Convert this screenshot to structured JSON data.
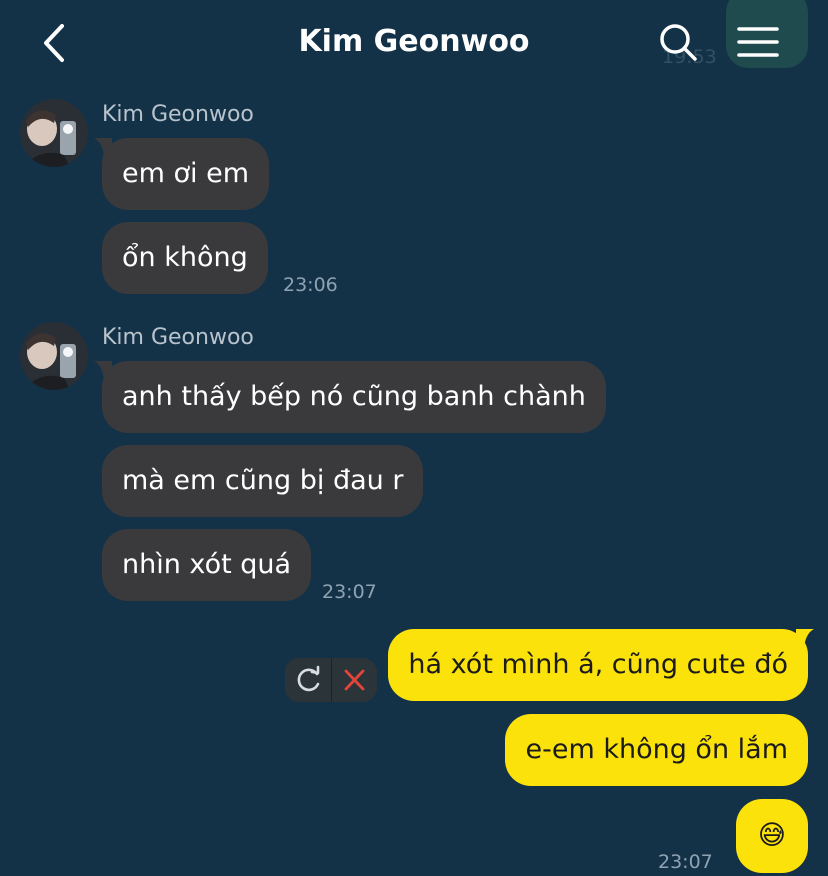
{
  "header": {
    "title": "Kim Geonwoo",
    "ghost_time": "19:53"
  },
  "groups": [
    {
      "sender": "Kim Geonwoo",
      "messages": [
        "em ơi em",
        "ổn không"
      ],
      "time": "23:06"
    },
    {
      "sender": "Kim Geonwoo",
      "messages": [
        "anh thấy bếp nó cũng banh chành",
        "mà em cũng bị đau r",
        "nhìn xót quá"
      ],
      "time": "23:07"
    }
  ],
  "outgoing": {
    "messages": [
      "há xót mình á, cũng cute đó",
      "e-em không ổn lắm",
      "😅"
    ],
    "time": "23:07"
  },
  "colors": {
    "background": "#133248",
    "incoming_bubble": "#3a3a3c",
    "outgoing_bubble": "#fbe20b",
    "failed_action_red": "#e0443a"
  },
  "icons": [
    "back-chevron-icon",
    "search-icon",
    "menu-icon",
    "retry-icon",
    "delete-x-icon"
  ]
}
